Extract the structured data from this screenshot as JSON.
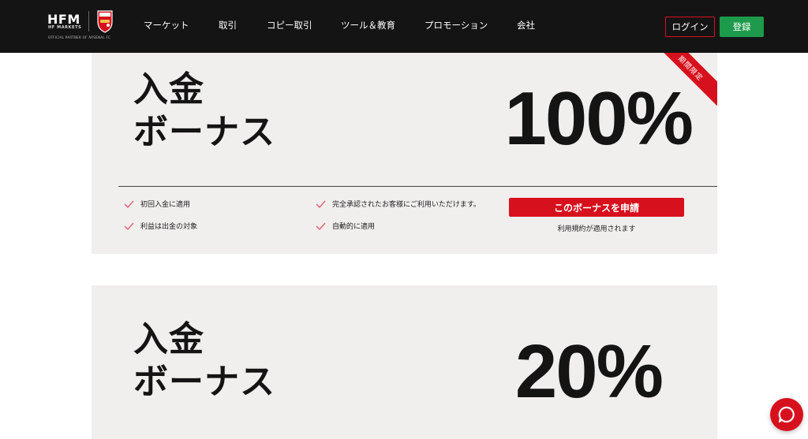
{
  "header": {
    "logo_text": "HFM",
    "logo_sub": "HF MARKETS",
    "logo_partner": "OFFICIAL PARTNER OF ARSENAL FC",
    "nav": [
      {
        "label": "マーケット"
      },
      {
        "label": "取引"
      },
      {
        "label": "コピー取引"
      },
      {
        "label": "ツール＆教育"
      },
      {
        "label": "プロモーション"
      },
      {
        "label": "会社"
      }
    ],
    "login_label": "ログイン",
    "register_label": "登録"
  },
  "cards": [
    {
      "title_line1": "入金",
      "title_line2": "ボーナス",
      "percent": "100%",
      "ribbon": "期間限定",
      "features": [
        "初回入金に適用",
        "利益は出金の対象",
        "完全承認されたお客様にご利用いただけます。",
        "自動的に適用"
      ],
      "cta_label": "このボーナスを申請",
      "terms": "利用規約が適用されます"
    },
    {
      "title_line1": "入金",
      "title_line2": "ボーナス",
      "percent": "20%"
    }
  ],
  "colors": {
    "brand_red": "#d7101d",
    "register_green": "#1d9a4b",
    "header_bg": "#141414",
    "card_bg": "#f0efee"
  },
  "icons": {
    "check": "check-icon",
    "chat": "chat-icon",
    "crest": "arsenal-crest-icon"
  }
}
